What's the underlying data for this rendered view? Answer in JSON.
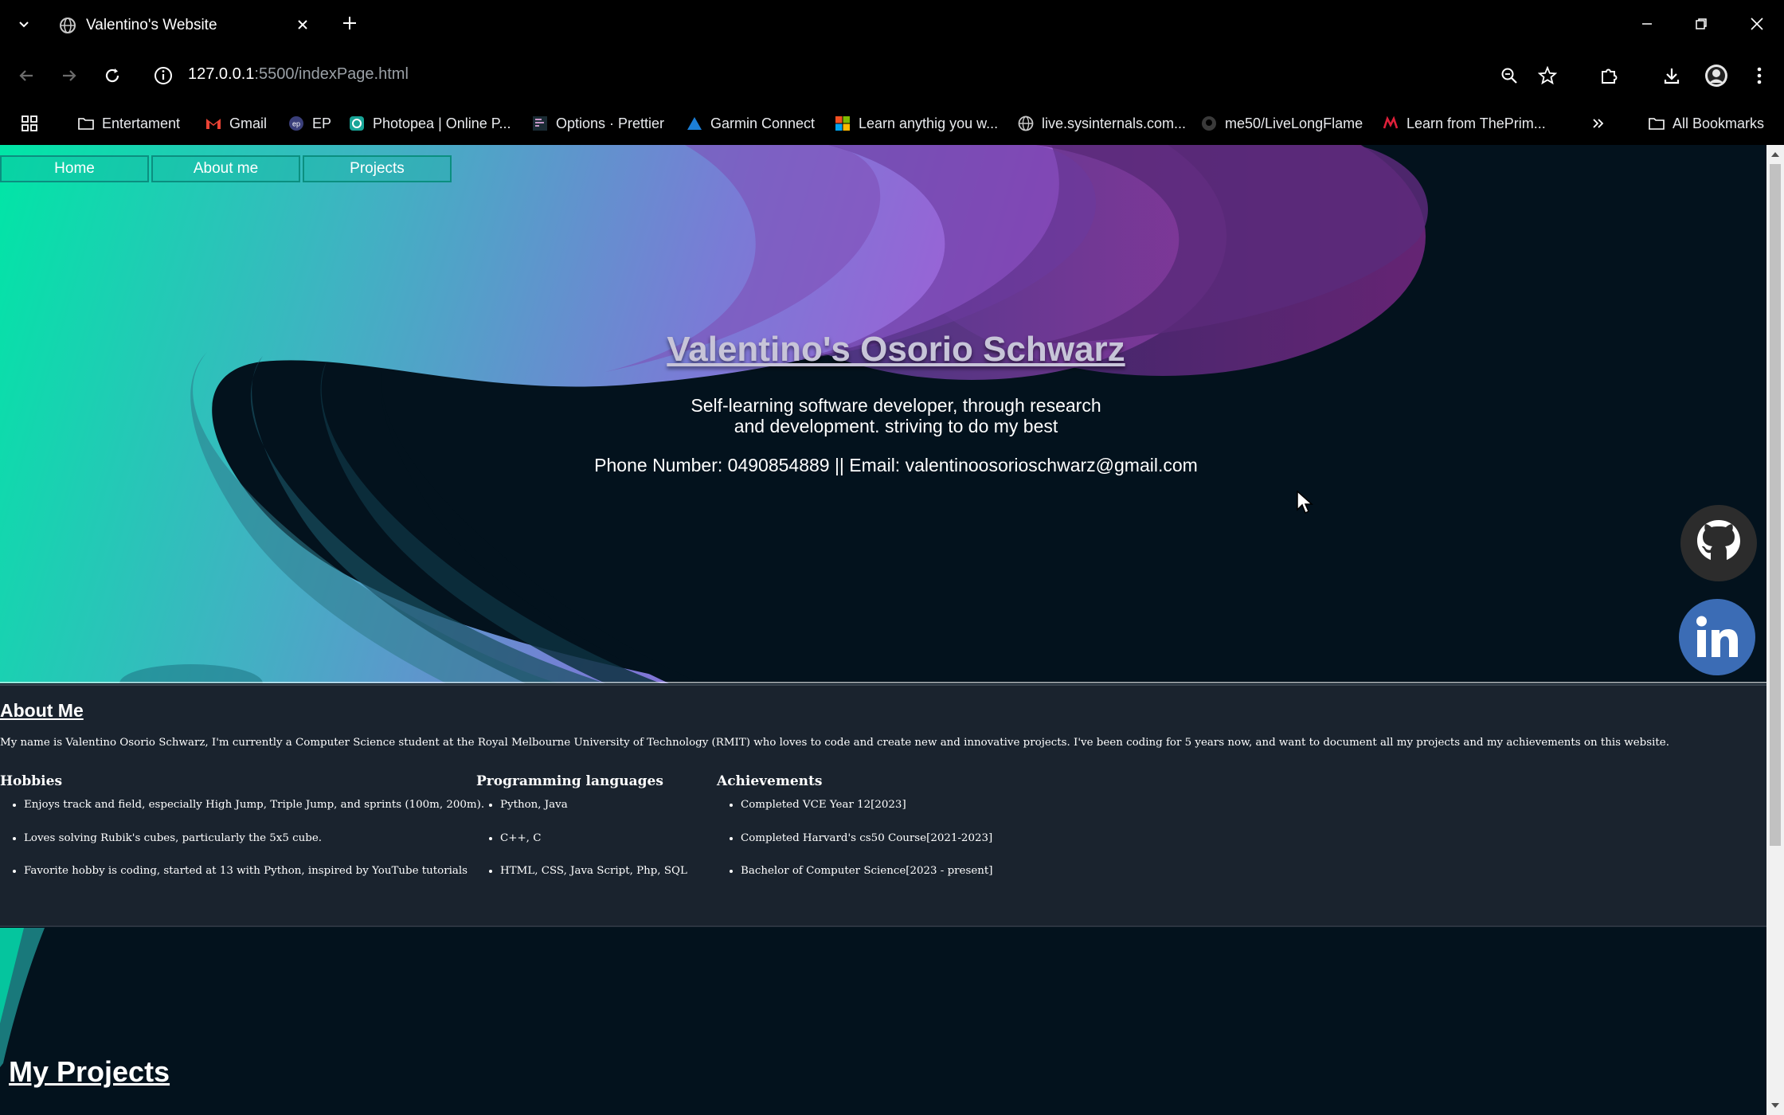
{
  "browser": {
    "tab_title": "Valentino's Website",
    "url_host": "127.0.0.1",
    "url_rest": ":5500/indexPage.html",
    "bookmarks": [
      {
        "label": "Entertament",
        "icon": "folder-icon"
      },
      {
        "label": "Gmail",
        "icon": "gmail-icon"
      },
      {
        "label": "EP",
        "icon": "ep-icon"
      },
      {
        "label": "Photopea | Online P...",
        "icon": "photopea-icon"
      },
      {
        "label": "Options · Prettier",
        "icon": "prettier-icon"
      },
      {
        "label": "Garmin Connect",
        "icon": "garmin-icon"
      },
      {
        "label": "Learn anythig you w...",
        "icon": "microsoft-icon"
      },
      {
        "label": "live.sysinternals.com...",
        "icon": "globe-icon"
      },
      {
        "label": "me50/LiveLongFlame",
        "icon": "github-icon"
      },
      {
        "label": "Learn from ThePrim...",
        "icon": "primeagen-icon"
      }
    ],
    "all_bookmarks": "All Bookmarks"
  },
  "page": {
    "nav": [
      "Home",
      "About me",
      "Projects"
    ],
    "hero": {
      "title": "Valentino's Osorio Schwarz",
      "subtitle_line1": "Self-learning software developer, through research",
      "subtitle_line2": "and development. striving to do my best",
      "contact": "Phone Number: 0490854889 || Email: valentinoosorioschwarz@gmail.com"
    },
    "about": {
      "heading": "About Me",
      "intro": "My name is Valentino Osorio Schwarz, I'm currently a Computer Science student at the Royal Melbourne University of Technology (RMIT) who loves to code and create new and innovative projects. I've been coding for 5 years now, and want to document all my projects and my achievements on this website.",
      "hobbies": {
        "heading": "Hobbies",
        "items": [
          "Enjoys track and field, especially High Jump, Triple Jump, and sprints (100m, 200m).",
          "Loves solving Rubik's cubes, particularly the 5x5 cube.",
          "Favorite hobby is coding, started at 13 with Python, inspired by YouTube tutorials"
        ]
      },
      "languages": {
        "heading": "Programming languages",
        "items": [
          "Python, Java",
          "C++, C",
          "HTML, CSS, Java Script, Php, SQL"
        ]
      },
      "achievements": {
        "heading": "Achievements",
        "items": [
          "Completed VCE Year 12[2023]",
          "Completed Harvard's cs50 Course[2021-2023]",
          "Bachelor of Computer Science[2023 - present]"
        ]
      }
    },
    "projects_heading": "My Projects"
  },
  "colors": {
    "teal": "#00e0a8",
    "purple": "#a05ad8",
    "dark_navy": "#03121d",
    "about_bg": "#1a232e",
    "linkedin": "#3b6cb5"
  }
}
